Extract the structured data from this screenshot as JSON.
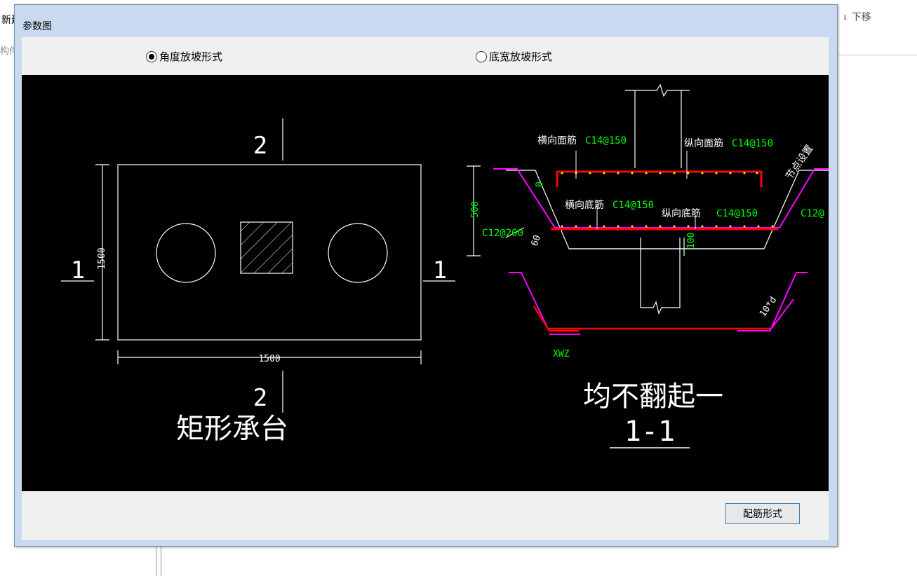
{
  "background": {
    "left_label": "新建",
    "left_text_2": "构件",
    "right_button": "下移"
  },
  "dialog": {
    "title": "参数图",
    "radio_1": "角度放坡形式",
    "radio_2": "底宽放坡形式",
    "button": "配筋形式"
  },
  "drawing": {
    "section_mark_top": "2",
    "section_mark_bottom": "2",
    "section_mark_left": "1",
    "section_mark_right": "1",
    "dim_width": "1500",
    "dim_height": "1500",
    "plan_title": "矩形承台",
    "label_top_transverse": "横向面筋",
    "value_top_transverse": "C14@150",
    "label_top_longitudinal": "纵向面筋",
    "value_top_longitudinal": "C14@150",
    "label_bottom_transverse": "横向底筋",
    "value_bottom_transverse": "C14@150",
    "label_bottom_longitudinal": "纵向底筋",
    "value_bottom_longitudinal": "C14@150",
    "label_node": "节点设置",
    "value_side_left": "C12@200",
    "value_side_right": "C12@",
    "dim_cover_top": "0",
    "dim_depth": "500",
    "dim_angle": "60",
    "dim_bottom": "100",
    "dim_anchor": "10*d",
    "dim_xwz": "XWZ",
    "section_note": "均不翻起一",
    "section_title": "1-1"
  },
  "colors": {
    "canvas": "#000000",
    "line": "#ffffff",
    "rebar_red": "#ff0000",
    "rebar_magenta": "#ff00ff",
    "dim_green": "#00ff00",
    "dots_yellow": "#ffff00"
  }
}
